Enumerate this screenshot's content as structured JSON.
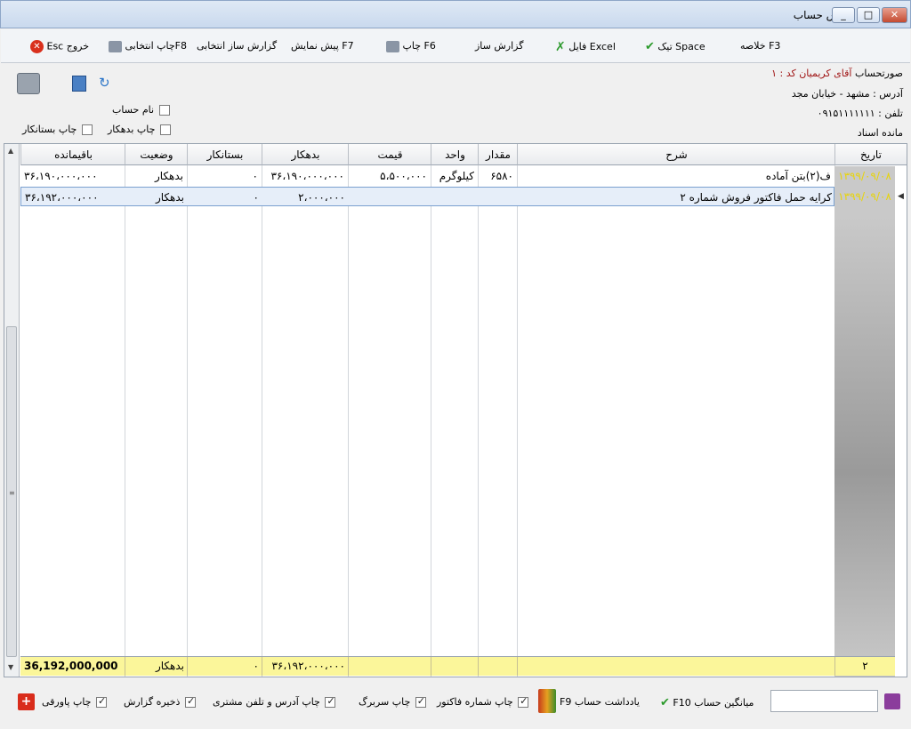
{
  "window": {
    "title": "گردش حساب",
    "min": "_",
    "max": "□",
    "close": "✕"
  },
  "toolbar": {
    "summary": "خلاصه F3",
    "tick": "تیک Space",
    "excel": "فایل Excel",
    "report_builder": "گزارش ساز",
    "print": "چاپ F6",
    "preview": "پیش نمایش F7",
    "selective_builder": "گزارش ساز انتخابی",
    "selective_print": "چاپ انتخابیF8",
    "exit": "خروج",
    "exit_key": "Esc"
  },
  "info": {
    "account_label": "صورتحساب",
    "account_value": "آقای کریمیان کد : ۱",
    "address": "آدرس : مشهد - خیابان مجد",
    "phone": "تلفن : ۰۹۱۵۱۱۱۱۱۱۱",
    "balance_label": "مانده اسناد",
    "cb_name": "نام حساب",
    "cb_debtor": "چاپ بدهکار",
    "cb_creditor": "چاپ بستانکار"
  },
  "grid": {
    "headers": {
      "date": "تاریخ",
      "desc": "شرح",
      "qty": "مقدار",
      "unit": "واحد",
      "price": "قیمت",
      "debit": "بدهکار",
      "credit": "بستانکار",
      "status": "وضعیت",
      "remaining": "باقیمانده"
    },
    "rows": [
      {
        "date": "۱۳۹۹/۰۹/۰۸",
        "desc": "ف(۲)بتن آماده",
        "qty": "۶۵۸۰",
        "unit": "کیلوگرم",
        "price": "۵،۵۰۰،۰۰۰",
        "debit": "۳۶،۱۹۰،۰۰۰،۰۰۰",
        "credit": "۰",
        "status": "بدهکار",
        "remaining": "۳۶،۱۹۰،۰۰۰،۰۰۰"
      },
      {
        "date": "۱۳۹۹/۰۹/۰۸",
        "desc": "کرایه حمل فاکتور فروش شماره ۲",
        "qty": "",
        "unit": "",
        "price": "",
        "debit": "۲،۰۰۰،۰۰۰",
        "credit": "۰",
        "status": "بدهکار",
        "remaining": "۳۶،۱۹۲،۰۰۰،۰۰۰"
      }
    ],
    "footer": {
      "count": "۲",
      "debit": "۳۶،۱۹۲،۰۰۰،۰۰۰",
      "credit": "۰",
      "status": "بدهکار",
      "remaining": "36,192,000,000"
    }
  },
  "bottom": {
    "average": "میانگین حساب",
    "average_key": "F10",
    "note": "یادداشت حساب F9",
    "cb_invoice_no": "چاپ شماره فاکتور",
    "cb_header": "چاپ سربرگ",
    "cb_address_phone": "چاپ آدرس و تلفن مشتری",
    "cb_save_report": "ذخیره گزارش",
    "cb_footnote": "چاپ پاورقی",
    "search_value": ""
  },
  "colors": {
    "date_text": "#e7d40a",
    "footer_bg": "#fbf69a",
    "selection_bg": "#e6eef9",
    "red_text": "#a01515"
  }
}
